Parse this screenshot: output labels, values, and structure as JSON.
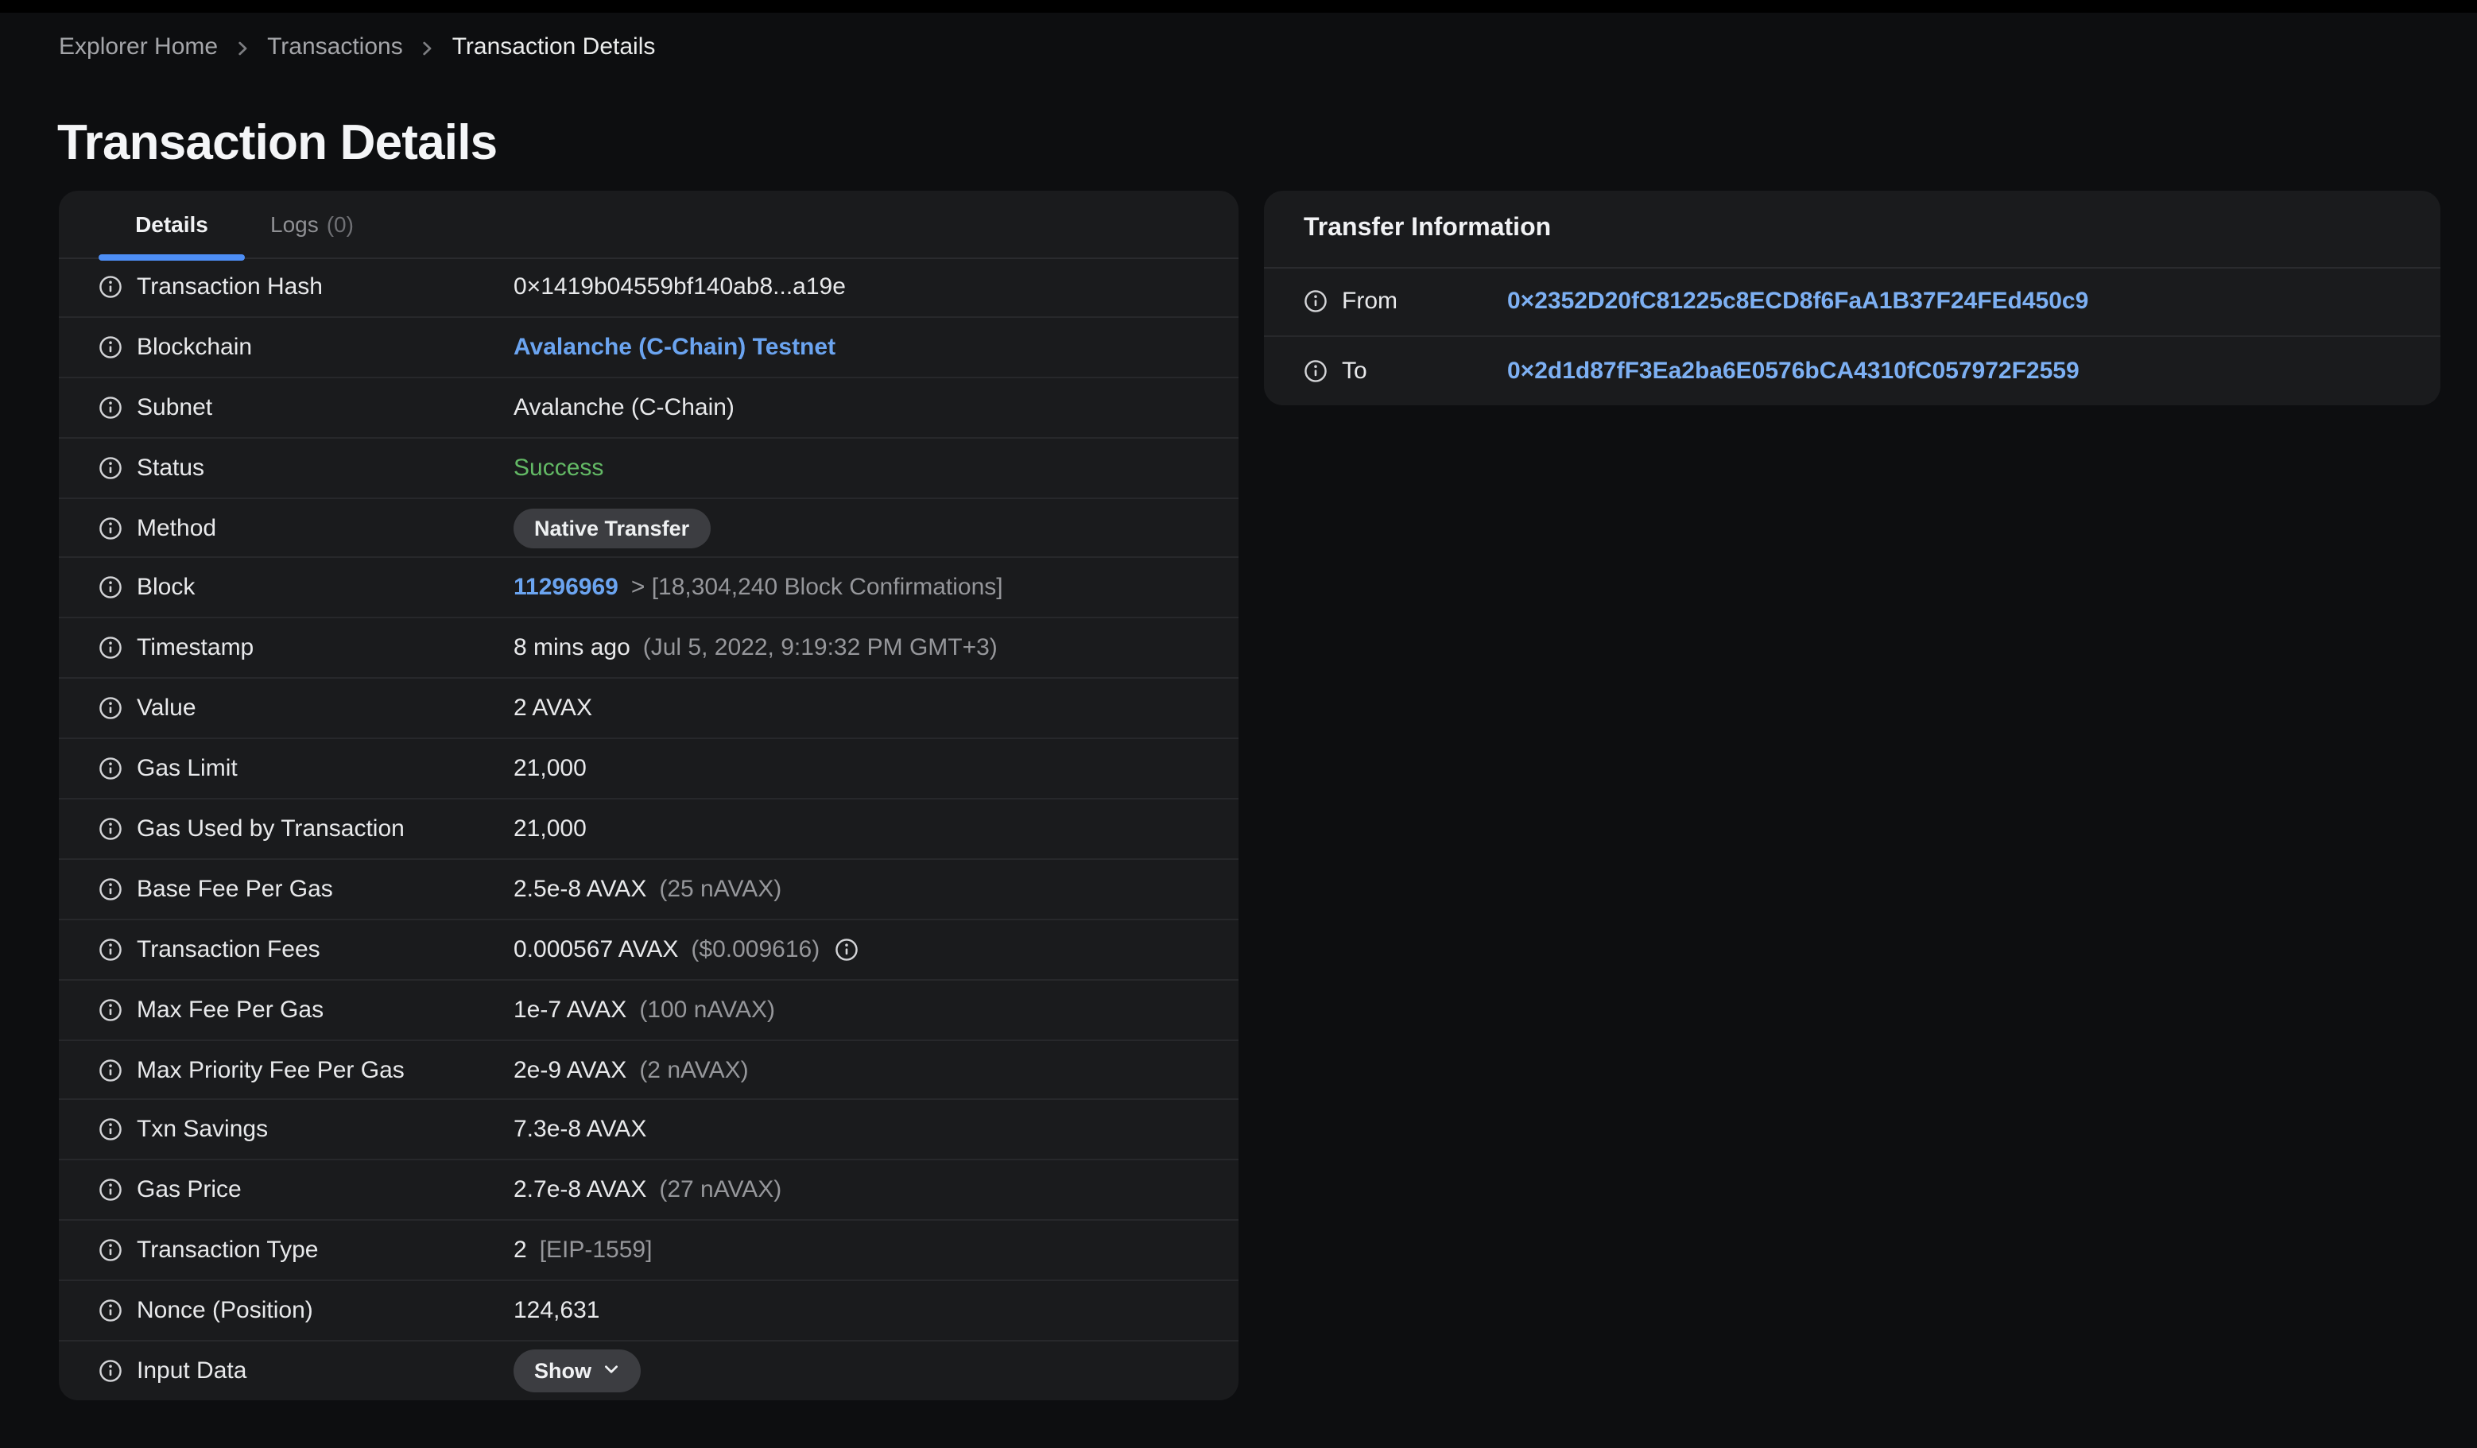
{
  "page": {
    "title": "Transaction Details",
    "breadcrumb": {
      "items": [
        {
          "label": "Explorer Home",
          "current": false
        },
        {
          "label": "Transactions",
          "current": false
        },
        {
          "label": "Transaction Details",
          "current": true
        }
      ],
      "separator_icon": "chevron-right-icon"
    }
  },
  "colors": {
    "background": "#0d0e10",
    "panel_background": "#1a1b1d",
    "divider": "#27282b",
    "text_primary": "#e8e9eb",
    "text_secondary": "#96979b",
    "link_blue": "#6ba4f0",
    "address_blue": "#7db0f3",
    "success_green": "#63b965",
    "tab_underline_blue": "#4d8ef5",
    "badge_background": "#3c3d41"
  },
  "details_panel": {
    "tabs": [
      {
        "label": "Details",
        "active": true
      },
      {
        "label": "Logs",
        "count": "(0)",
        "active": false
      }
    ],
    "row_icon": "info-icon",
    "rows": [
      {
        "label": "Transaction Hash",
        "value_type": "text",
        "value": "0×1419b04559bf140ab8...a19e"
      },
      {
        "label": "Blockchain",
        "value_type": "link",
        "value": "Avalanche (C-Chain) Testnet"
      },
      {
        "label": "Subnet",
        "value_type": "text",
        "value": "Avalanche (C-Chain)"
      },
      {
        "label": "Status",
        "value_type": "status",
        "value": "Success"
      },
      {
        "label": "Method",
        "value_type": "badge",
        "value": "Native Transfer"
      },
      {
        "label": "Block",
        "value_type": "link_suffix",
        "value": "11296969",
        "suffix": "> [18,304,240 Block Confirmations]"
      },
      {
        "label": "Timestamp",
        "value_type": "text_suffix",
        "value": "8 mins ago",
        "suffix": "(Jul 5, 2022, 9:19:32 PM GMT+3)"
      },
      {
        "label": "Value",
        "value_type": "text",
        "value": "2 AVAX"
      },
      {
        "label": "Gas Limit",
        "value_type": "text",
        "value": "21,000"
      },
      {
        "label": "Gas Used by Transaction",
        "value_type": "text",
        "value": "21,000"
      },
      {
        "label": "Base Fee Per Gas",
        "value_type": "text_suffix",
        "value": "2.5e-8 AVAX",
        "suffix": "(25 nAVAX)"
      },
      {
        "label": "Transaction Fees",
        "value_type": "text_suffix_icon",
        "value": "0.000567 AVAX",
        "suffix": "($0.009616)",
        "trailing_icon": "info-icon"
      },
      {
        "label": "Max Fee Per Gas",
        "value_type": "text_suffix",
        "value": "1e-7 AVAX",
        "suffix": "(100 nAVAX)"
      },
      {
        "label": "Max Priority Fee Per Gas",
        "value_type": "text_suffix",
        "value": "2e-9 AVAX",
        "suffix": "(2 nAVAX)"
      },
      {
        "label": "Txn Savings",
        "value_type": "text",
        "value": "7.3e-8 AVAX"
      },
      {
        "label": "Gas Price",
        "value_type": "text_suffix",
        "value": "2.7e-8 AVAX",
        "suffix": "(27 nAVAX)"
      },
      {
        "label": "Transaction Type",
        "value_type": "text_suffix",
        "value": "2",
        "suffix": "[EIP-1559]"
      },
      {
        "label": "Nonce (Position)",
        "value_type": "text",
        "value": "124,631"
      },
      {
        "label": "Input Data",
        "value_type": "button",
        "value": "Show",
        "button_icon": "chevron-down-icon"
      }
    ]
  },
  "transfer_panel": {
    "title": "Transfer Information",
    "row_icon": "info-icon",
    "rows": [
      {
        "label": "From",
        "address": "0×2352D20fC81225c8ECD8f6FaA1B37F24FEd450c9"
      },
      {
        "label": "To",
        "address": "0×2d1d87fF3Ea2ba6E0576bCA4310fC057972F2559"
      }
    ]
  }
}
